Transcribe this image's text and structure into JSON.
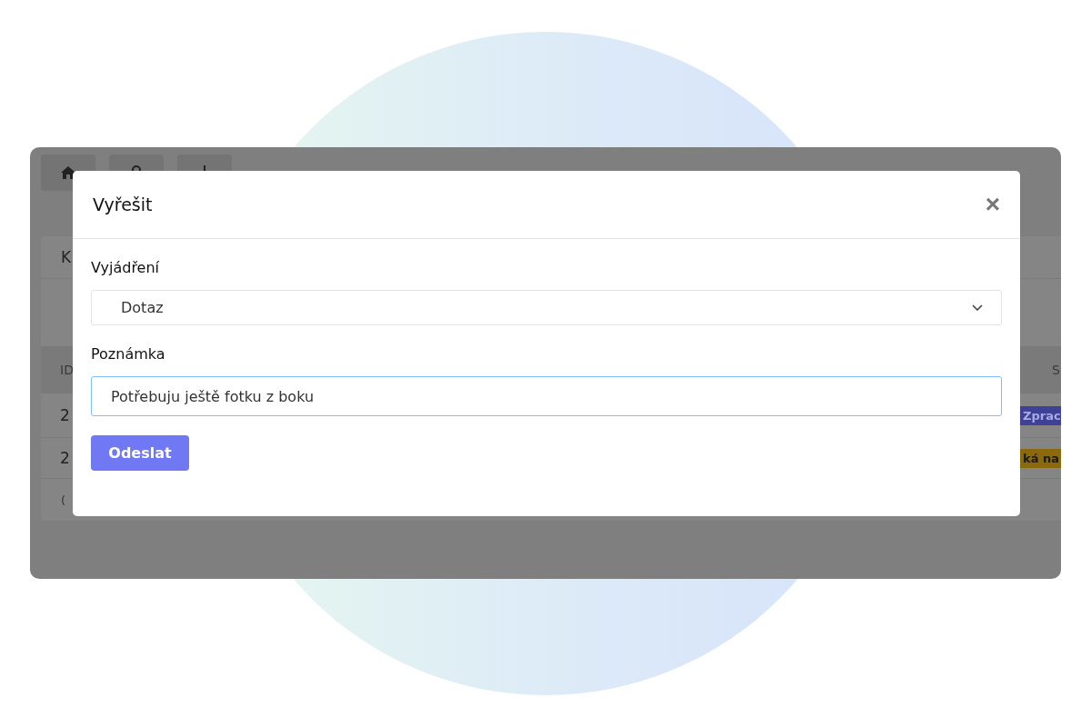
{
  "app": {
    "card": {
      "title": "K",
      "table": {
        "columns": [
          "ID",
          "S"
        ],
        "rows": [
          {
            "id": "2",
            "status": "Zprac",
            "color": "#3f4196"
          },
          {
            "id": "2",
            "status": "ká na",
            "color": "#8a6a0c"
          }
        ]
      },
      "footer": "("
    }
  },
  "dialog": {
    "title": "Vyřešit",
    "close": "×",
    "fields": [
      {
        "kind": "select",
        "label": "Vyjádření",
        "value": "Dotaz",
        "focused": false
      },
      {
        "kind": "text",
        "label": "Poznámka",
        "value": "Potřebuju ještě fotku z boku",
        "focused": true
      }
    ],
    "submit": "Odeslat"
  }
}
